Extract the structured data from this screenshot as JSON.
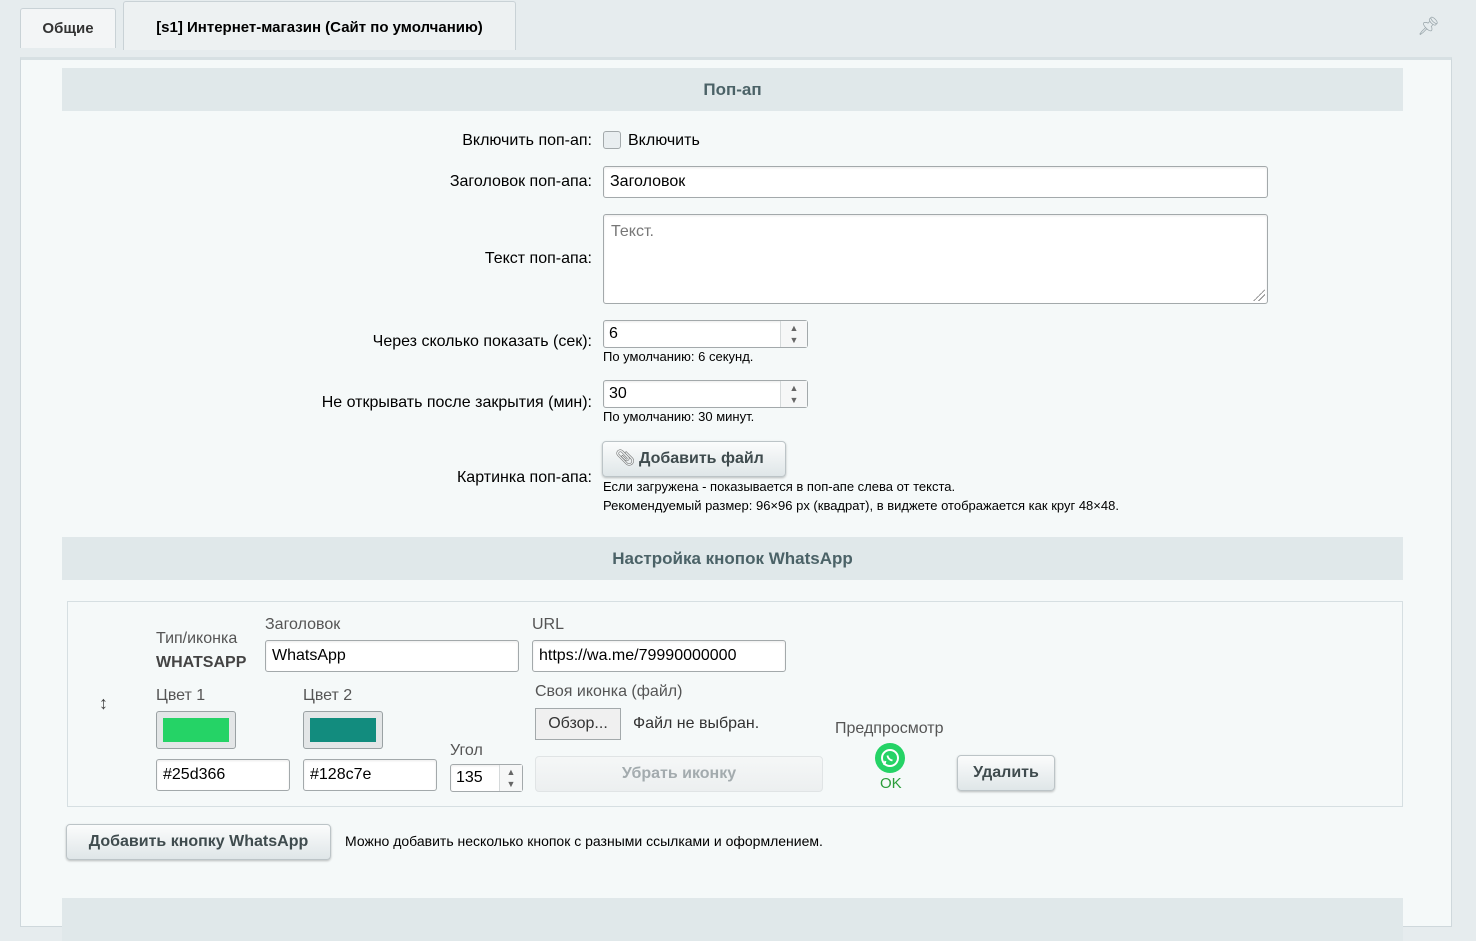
{
  "tabs": [
    {
      "label": "Общие"
    },
    {
      "label": "[s1] Интернет-магазин (Сайт по умолчанию)"
    }
  ],
  "popup": {
    "section_title": "Поп-ап",
    "enable_label": "Включить поп-ап:",
    "enable_checkbox_label": "Включить",
    "title_label": "Заголовок поп-апа:",
    "title_value": "Заголовок",
    "text_label": "Текст поп-апа:",
    "text_placeholder": "Текст.",
    "delay_label": "Через сколько показать (сек):",
    "delay_value": "6",
    "delay_hint": "По умолчанию: 6 секунд.",
    "noopen_label": "Не открывать после закрытия (мин):",
    "noopen_value": "30",
    "noopen_hint": "По умолчанию: 30 минут.",
    "image_label": "Картинка поп-апа:",
    "add_file_button": "Добавить файл",
    "image_hint1": "Если загружена - показывается в поп-апе слева от текста.",
    "image_hint2": "Рекомендуемый размер: 96×96 px (квадрат), в виджете отображается как круг 48×48."
  },
  "whatsapp": {
    "section_title": "Настройка кнопок WhatsApp",
    "type_label": "Тип/иконка",
    "type_value": "WHATSAPP",
    "title_label": "Заголовок",
    "title_value": "WhatsApp",
    "url_label": "URL",
    "url_value": "https://wa.me/79990000000",
    "color1_label": "Цвет 1",
    "color1_value": "#25d366",
    "color2_label": "Цвет 2",
    "color2_value": "#128c7e",
    "angle_label": "Угол",
    "angle_value": "135",
    "icon_file_label": "Своя иконка (файл)",
    "browse_button": "Обзор...",
    "no_file_text": "Файл не выбран.",
    "remove_icon_button": "Убрать иконку",
    "preview_label": "Предпросмотр",
    "preview_status": "OK",
    "delete_button": "Удалить",
    "add_button": "Добавить кнопку WhatsApp",
    "add_hint": "Можно добавить несколько кнопок с разными ссылками и оформлением."
  }
}
